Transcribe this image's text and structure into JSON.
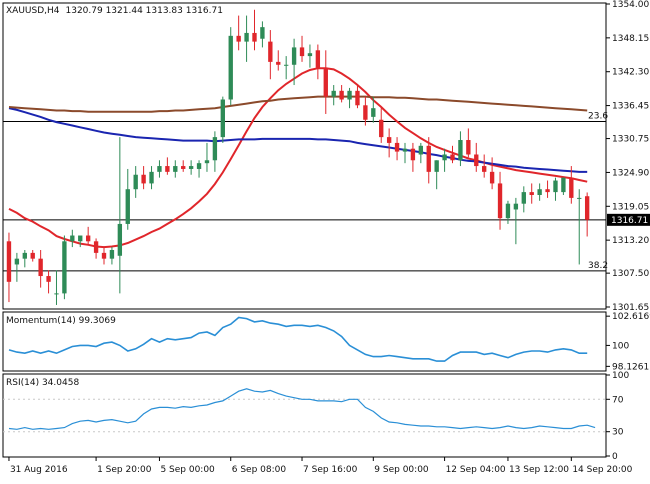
{
  "header": {
    "symbol": "XAUUSD,H4",
    "ohlc": "1320.79 1321.44 1313.83 1316.71"
  },
  "colors": {
    "bull": "#2e8b57",
    "bear": "#e0262b",
    "ma_fast": "#e0262b",
    "ma_mid": "#1a25b0",
    "ma_slow": "#8b4a2b",
    "indicator": "#2a8fd6",
    "current_price_bg": "#000000"
  },
  "chart_data": [
    {
      "type": "candlestick",
      "panel": "main",
      "ylim": [
        1301.65,
        1354.0
      ],
      "y_ticks": [
        "1354.00",
        "1348.15",
        "1342.30",
        "1336.45",
        "1330.75",
        "1324.90",
        "1319.05",
        "1313.20",
        "1307.50",
        "1301.65"
      ],
      "x_ticks": [
        "31 Aug 2016",
        "1 Sep 20:00",
        "5 Sep 00:00",
        "6 Sep 08:00",
        "7 Sep 16:00",
        "9 Sep 00:00",
        "12 Sep 04:00",
        "13 Sep 12:00",
        "14 Sep 20:00"
      ],
      "current_price": "1316.71",
      "levels": [
        {
          "label": "23.6",
          "value": 1333.7
        },
        {
          "label": "38.2",
          "value": 1307.9
        }
      ],
      "candles": [
        {
          "o": 1313.0,
          "h": 1314.5,
          "l": 1302.5,
          "c": 1306.0
        },
        {
          "o": 1309.0,
          "h": 1311.0,
          "l": 1306.0,
          "c": 1310.0
        },
        {
          "o": 1310.0,
          "h": 1311.5,
          "l": 1308.5,
          "c": 1311.0
        },
        {
          "o": 1311.0,
          "h": 1311.5,
          "l": 1309.5,
          "c": 1310.0
        },
        {
          "o": 1310.0,
          "h": 1311.5,
          "l": 1305.0,
          "c": 1307.0
        },
        {
          "o": 1307.0,
          "h": 1308.0,
          "l": 1304.0,
          "c": 1306.0
        },
        {
          "o": 1304.0,
          "h": 1308.0,
          "l": 1302.0,
          "c": 1304.0
        },
        {
          "o": 1304.0,
          "h": 1314.0,
          "l": 1303.0,
          "c": 1313.0
        },
        {
          "o": 1313.0,
          "h": 1315.0,
          "l": 1312.0,
          "c": 1314.0
        },
        {
          "o": 1313.0,
          "h": 1314.0,
          "l": 1312.0,
          "c": 1314.0
        },
        {
          "o": 1314.0,
          "h": 1315.5,
          "l": 1312.5,
          "c": 1313.0
        },
        {
          "o": 1313.0,
          "h": 1313.5,
          "l": 1310.0,
          "c": 1311.0
        },
        {
          "o": 1311.0,
          "h": 1312.0,
          "l": 1309.0,
          "c": 1310.0
        },
        {
          "o": 1310.0,
          "h": 1312.0,
          "l": 1309.0,
          "c": 1311.5
        },
        {
          "o": 1310.5,
          "h": 1331.0,
          "l": 1304.0,
          "c": 1316.0
        },
        {
          "o": 1316.0,
          "h": 1325.5,
          "l": 1315.0,
          "c": 1322.0
        },
        {
          "o": 1322.0,
          "h": 1326.0,
          "l": 1320.5,
          "c": 1324.5
        },
        {
          "o": 1324.5,
          "h": 1326.0,
          "l": 1322.0,
          "c": 1323.0
        },
        {
          "o": 1323.0,
          "h": 1326.0,
          "l": 1322.0,
          "c": 1325.0
        },
        {
          "o": 1325.0,
          "h": 1327.0,
          "l": 1324.0,
          "c": 1326.0
        },
        {
          "o": 1326.0,
          "h": 1327.5,
          "l": 1324.5,
          "c": 1325.0
        },
        {
          "o": 1325.0,
          "h": 1327.0,
          "l": 1324.0,
          "c": 1326.0
        },
        {
          "o": 1326.0,
          "h": 1327.0,
          "l": 1325.0,
          "c": 1325.5
        },
        {
          "o": 1325.5,
          "h": 1327.0,
          "l": 1324.5,
          "c": 1326.0
        },
        {
          "o": 1325.5,
          "h": 1327.0,
          "l": 1324.0,
          "c": 1326.5
        },
        {
          "o": 1326.5,
          "h": 1330.0,
          "l": 1325.0,
          "c": 1327.0
        },
        {
          "o": 1327.0,
          "h": 1332.0,
          "l": 1325.0,
          "c": 1331.0
        },
        {
          "o": 1331.0,
          "h": 1338.0,
          "l": 1330.0,
          "c": 1337.5
        },
        {
          "o": 1337.5,
          "h": 1350.0,
          "l": 1336.5,
          "c": 1348.5
        },
        {
          "o": 1348.5,
          "h": 1352.0,
          "l": 1346.0,
          "c": 1347.5
        },
        {
          "o": 1347.5,
          "h": 1352.0,
          "l": 1344.0,
          "c": 1349.0
        },
        {
          "o": 1349.0,
          "h": 1353.0,
          "l": 1346.0,
          "c": 1347.5
        },
        {
          "o": 1348.0,
          "h": 1351.0,
          "l": 1346.5,
          "c": 1350.0
        },
        {
          "o": 1347.5,
          "h": 1349.5,
          "l": 1341.0,
          "c": 1344.0
        },
        {
          "o": 1344.0,
          "h": 1346.0,
          "l": 1342.5,
          "c": 1343.5
        },
        {
          "o": 1343.5,
          "h": 1345.0,
          "l": 1341.0,
          "c": 1343.5
        },
        {
          "o": 1343.5,
          "h": 1348.0,
          "l": 1340.0,
          "c": 1346.5
        },
        {
          "o": 1346.5,
          "h": 1348.5,
          "l": 1344.0,
          "c": 1345.0
        },
        {
          "o": 1345.0,
          "h": 1347.0,
          "l": 1343.0,
          "c": 1345.5
        },
        {
          "o": 1346.0,
          "h": 1347.0,
          "l": 1341.0,
          "c": 1343.0
        },
        {
          "o": 1343.0,
          "h": 1346.0,
          "l": 1335.0,
          "c": 1338.0
        },
        {
          "o": 1338.0,
          "h": 1340.0,
          "l": 1336.5,
          "c": 1339.0
        },
        {
          "o": 1339.0,
          "h": 1340.0,
          "l": 1337.0,
          "c": 1337.5
        },
        {
          "o": 1337.5,
          "h": 1339.5,
          "l": 1336.0,
          "c": 1339.0
        },
        {
          "o": 1339.0,
          "h": 1340.0,
          "l": 1336.0,
          "c": 1336.5
        },
        {
          "o": 1336.5,
          "h": 1338.0,
          "l": 1333.0,
          "c": 1334.0
        },
        {
          "o": 1334.5,
          "h": 1338.0,
          "l": 1333.5,
          "c": 1336.0
        },
        {
          "o": 1334.0,
          "h": 1336.0,
          "l": 1330.0,
          "c": 1331.0
        },
        {
          "o": 1331.0,
          "h": 1332.5,
          "l": 1327.5,
          "c": 1330.0
        },
        {
          "o": 1330.0,
          "h": 1331.0,
          "l": 1327.0,
          "c": 1328.5
        },
        {
          "o": 1328.5,
          "h": 1330.0,
          "l": 1326.5,
          "c": 1329.0
        },
        {
          "o": 1329.0,
          "h": 1330.0,
          "l": 1325.0,
          "c": 1327.0
        },
        {
          "o": 1328.0,
          "h": 1330.0,
          "l": 1326.5,
          "c": 1329.5
        },
        {
          "o": 1329.5,
          "h": 1331.0,
          "l": 1323.0,
          "c": 1325.0
        },
        {
          "o": 1325.0,
          "h": 1327.0,
          "l": 1322.0,
          "c": 1327.0
        },
        {
          "o": 1327.0,
          "h": 1329.0,
          "l": 1325.0,
          "c": 1328.0
        },
        {
          "o": 1328.0,
          "h": 1329.5,
          "l": 1326.5,
          "c": 1327.0
        },
        {
          "o": 1327.0,
          "h": 1332.0,
          "l": 1326.0,
          "c": 1330.5
        },
        {
          "o": 1330.5,
          "h": 1332.5,
          "l": 1327.5,
          "c": 1328.0
        },
        {
          "o": 1328.0,
          "h": 1330.0,
          "l": 1325.0,
          "c": 1326.0
        },
        {
          "o": 1326.0,
          "h": 1328.0,
          "l": 1324.0,
          "c": 1325.0
        },
        {
          "o": 1325.0,
          "h": 1327.5,
          "l": 1322.0,
          "c": 1323.0
        },
        {
          "o": 1323.0,
          "h": 1325.0,
          "l": 1315.0,
          "c": 1317.0
        },
        {
          "o": 1317.0,
          "h": 1320.0,
          "l": 1316.0,
          "c": 1319.5
        },
        {
          "o": 1318.5,
          "h": 1320.5,
          "l": 1312.5,
          "c": 1319.5
        },
        {
          "o": 1319.5,
          "h": 1322.5,
          "l": 1318.0,
          "c": 1321.5
        },
        {
          "o": 1321.5,
          "h": 1323.0,
          "l": 1319.5,
          "c": 1321.0
        },
        {
          "o": 1321.0,
          "h": 1323.0,
          "l": 1320.0,
          "c": 1322.0
        },
        {
          "o": 1322.0,
          "h": 1323.5,
          "l": 1320.5,
          "c": 1321.5
        },
        {
          "o": 1321.5,
          "h": 1324.0,
          "l": 1320.0,
          "c": 1323.5
        },
        {
          "o": 1321.5,
          "h": 1324.0,
          "l": 1321.0,
          "c": 1324.0
        },
        {
          "o": 1324.0,
          "h": 1326.0,
          "l": 1319.5,
          "c": 1320.5
        },
        {
          "o": 1320.5,
          "h": 1322.0,
          "l": 1309.0,
          "c": 1320.5
        },
        {
          "o": 1320.79,
          "h": 1321.44,
          "l": 1313.83,
          "c": 1316.71
        }
      ],
      "moving_averages": [
        {
          "color_key": "ma_fast",
          "values": [
            1318.6,
            1317.9,
            1317.0,
            1316.4,
            1315.6,
            1314.9,
            1313.9,
            1313.4,
            1313.0,
            1312.6,
            1312.4,
            1312.1,
            1312.0,
            1312.1,
            1312.3,
            1312.7,
            1313.3,
            1313.9,
            1314.6,
            1315.2,
            1316.0,
            1316.8,
            1317.7,
            1318.7,
            1319.9,
            1321.2,
            1322.9,
            1324.9,
            1327.2,
            1329.6,
            1332.0,
            1334.3,
            1336.2,
            1337.7,
            1339.1,
            1340.2,
            1341.1,
            1342.0,
            1342.6,
            1342.9,
            1342.9,
            1342.7,
            1342.0,
            1341.1,
            1340.0,
            1338.8,
            1337.4,
            1336.2,
            1334.9,
            1333.7,
            1332.6,
            1331.7,
            1330.8,
            1330.0,
            1329.3,
            1328.8,
            1328.3,
            1327.8,
            1327.3,
            1327.0,
            1326.6,
            1326.2,
            1325.9,
            1325.6,
            1325.3,
            1325.1,
            1324.9,
            1324.7,
            1324.5,
            1324.3,
            1324.1,
            1323.9,
            1323.6,
            1323.3
          ]
        },
        {
          "color_key": "ma_mid",
          "values": [
            1336.0,
            1335.7,
            1335.3,
            1334.9,
            1334.5,
            1334.0,
            1333.6,
            1333.3,
            1333.0,
            1332.7,
            1332.4,
            1332.1,
            1331.8,
            1331.6,
            1331.4,
            1331.2,
            1331.0,
            1330.9,
            1330.8,
            1330.7,
            1330.6,
            1330.5,
            1330.4,
            1330.4,
            1330.4,
            1330.4,
            1330.3,
            1330.4,
            1330.5,
            1330.6,
            1330.6,
            1330.6,
            1330.7,
            1330.7,
            1330.7,
            1330.7,
            1330.7,
            1330.7,
            1330.7,
            1330.6,
            1330.6,
            1330.5,
            1330.4,
            1330.3,
            1330.0,
            1329.8,
            1329.6,
            1329.4,
            1329.2,
            1329.0,
            1328.8,
            1328.6,
            1328.4,
            1328.1,
            1327.9,
            1327.6,
            1327.4,
            1327.1,
            1326.9,
            1326.8,
            1326.6,
            1326.4,
            1326.2,
            1326.0,
            1325.9,
            1325.7,
            1325.6,
            1325.5,
            1325.4,
            1325.3,
            1325.2,
            1325.1,
            1325.0,
            1325.0
          ]
        },
        {
          "color_key": "ma_slow",
          "values": [
            1336.2,
            1336.1,
            1336.0,
            1335.9,
            1335.8,
            1335.7,
            1335.6,
            1335.6,
            1335.5,
            1335.5,
            1335.4,
            1335.4,
            1335.4,
            1335.4,
            1335.4,
            1335.4,
            1335.4,
            1335.4,
            1335.4,
            1335.5,
            1335.5,
            1335.6,
            1335.6,
            1335.7,
            1335.8,
            1335.9,
            1336.0,
            1336.2,
            1336.4,
            1336.6,
            1336.8,
            1337.0,
            1337.2,
            1337.3,
            1337.5,
            1337.6,
            1337.7,
            1337.8,
            1337.9,
            1338.0,
            1338.0,
            1338.0,
            1338.0,
            1338.0,
            1338.0,
            1338.0,
            1337.9,
            1337.9,
            1337.9,
            1337.8,
            1337.8,
            1337.7,
            1337.6,
            1337.5,
            1337.5,
            1337.4,
            1337.3,
            1337.2,
            1337.1,
            1337.0,
            1336.9,
            1336.8,
            1336.7,
            1336.6,
            1336.5,
            1336.4,
            1336.3,
            1336.2,
            1336.1,
            1336.0,
            1335.9,
            1335.8,
            1335.7,
            1335.6
          ]
        }
      ]
    },
    {
      "type": "line",
      "panel": "momentum",
      "title": "Momentum(14) 99.3069",
      "ylim": [
        97.8,
        102.9
      ],
      "y_ticks": [
        "102.6169",
        "100",
        "98.1261"
      ],
      "values": [
        99.6,
        99.4,
        99.3,
        99.5,
        99.3,
        99.5,
        99.3,
        99.6,
        99.9,
        100.0,
        100.0,
        99.9,
        100.2,
        100.3,
        100.0,
        99.5,
        99.7,
        100.1,
        100.6,
        100.3,
        100.6,
        100.5,
        100.6,
        100.7,
        101.1,
        101.2,
        100.9,
        101.6,
        101.9,
        102.5,
        102.4,
        102.1,
        102.2,
        102.0,
        101.9,
        101.7,
        101.8,
        101.8,
        101.7,
        101.8,
        101.6,
        101.3,
        100.8,
        100.0,
        99.6,
        99.2,
        99.0,
        99.0,
        99.1,
        99.0,
        98.9,
        98.8,
        98.8,
        98.8,
        98.6,
        98.6,
        99.1,
        99.4,
        99.4,
        99.4,
        99.2,
        99.3,
        99.1,
        98.9,
        99.2,
        99.4,
        99.5,
        99.5,
        99.4,
        99.6,
        99.7,
        99.6,
        99.3,
        99.3
      ]
    },
    {
      "type": "line",
      "panel": "rsi",
      "title": "RSI(14) 34.0458",
      "ylim": [
        0,
        100
      ],
      "y_ticks": [
        "100",
        "70",
        "30",
        "0"
      ],
      "levels": [
        70,
        30
      ],
      "values": [
        34,
        33,
        35,
        33,
        34,
        33,
        34,
        35,
        40,
        43,
        44,
        42,
        44,
        45,
        43,
        41,
        43,
        52,
        58,
        60,
        60,
        59,
        61,
        60,
        62,
        63,
        66,
        68,
        74,
        80,
        83,
        80,
        79,
        81,
        77,
        74,
        72,
        70,
        70,
        68,
        68,
        68,
        67,
        70,
        70,
        60,
        55,
        47,
        42,
        41,
        39,
        38,
        37,
        37,
        36,
        36,
        35,
        34,
        35,
        36,
        35,
        34,
        35,
        37,
        35,
        34,
        35,
        37,
        36,
        35,
        34,
        34,
        37,
        38,
        35
      ]
    }
  ]
}
